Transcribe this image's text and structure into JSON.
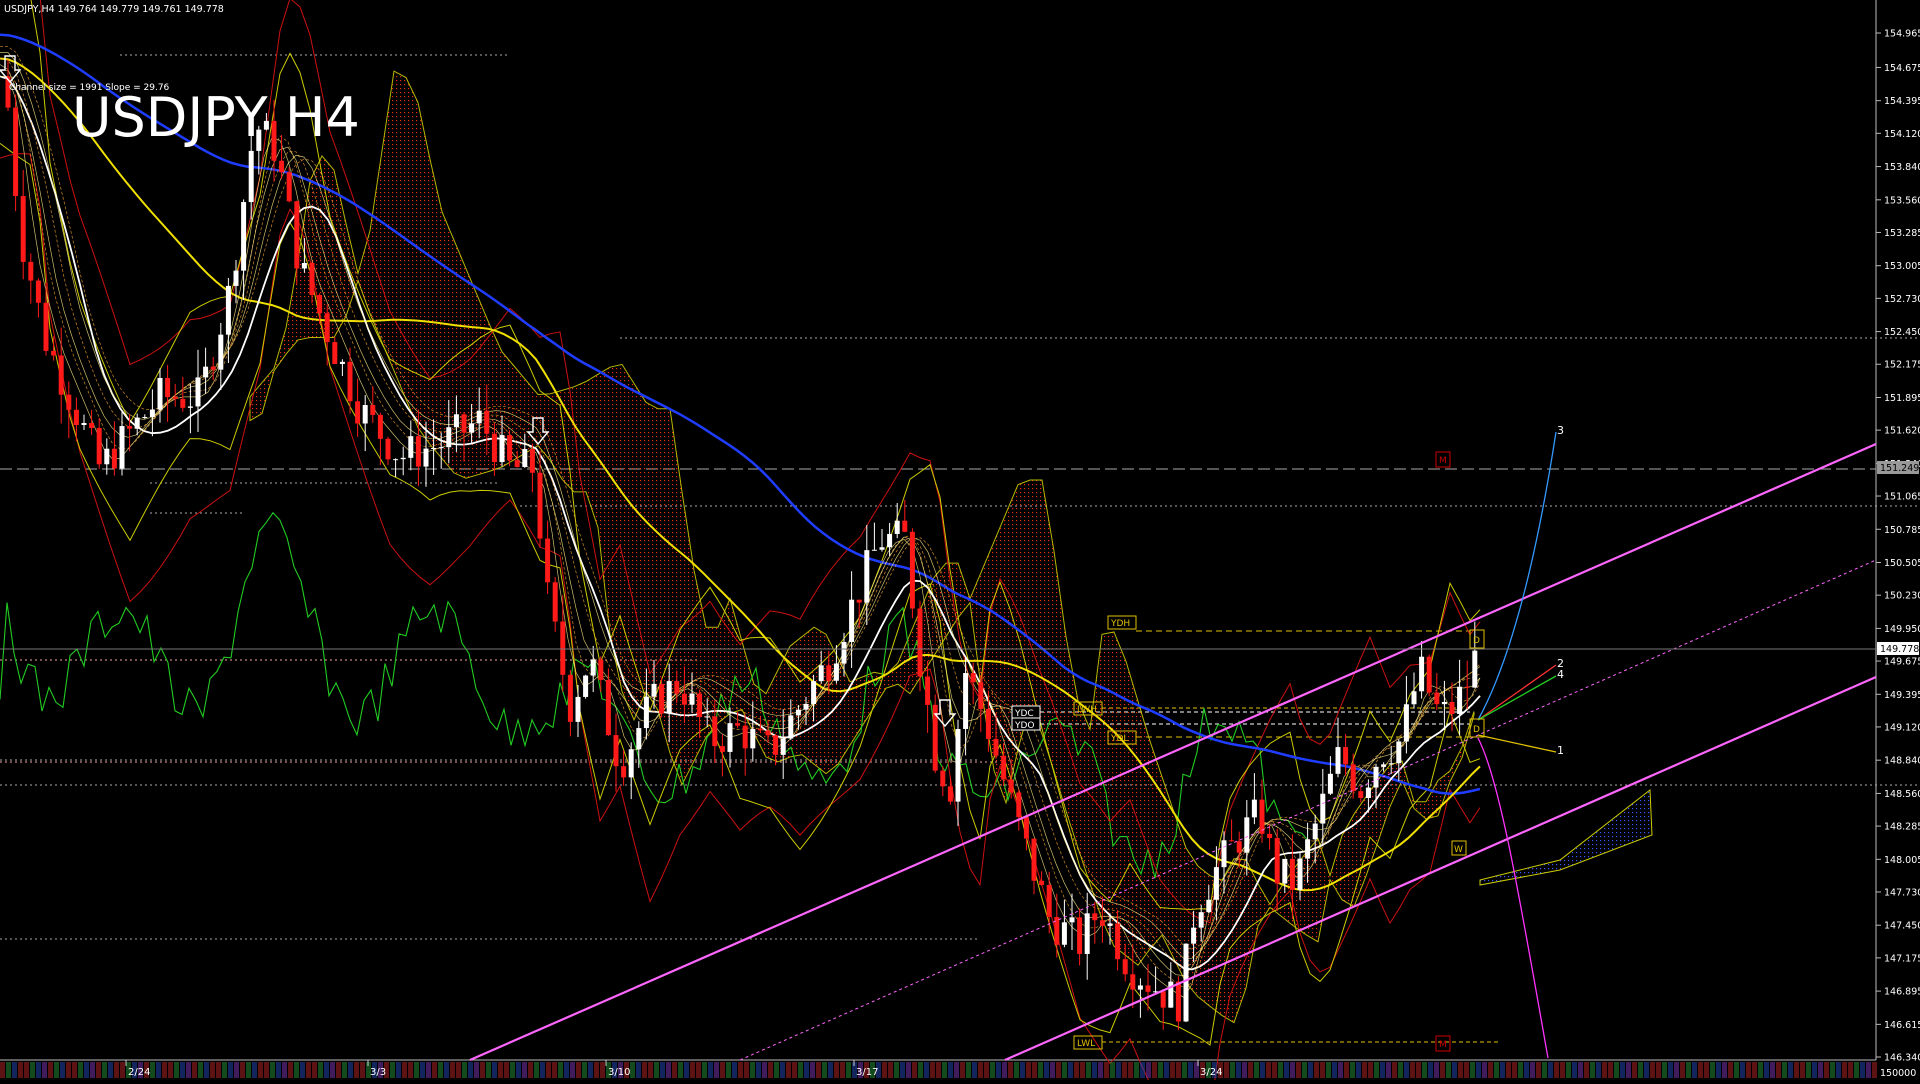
{
  "window": {
    "header_text": "USDJPY,H4  149.764 149.779 149.761 149.778",
    "title": "USDJPY H4",
    "channel_info": "Channel size = 1991 Slope = 29.76"
  },
  "price_scale": {
    "ticks": [
      "154.965",
      "154.675",
      "154.395",
      "154.120",
      "153.840",
      "153.560",
      "153.285",
      "153.005",
      "152.730",
      "152.450",
      "152.175",
      "151.895",
      "151.620",
      "151.340",
      "151.065",
      "150.785",
      "150.505",
      "150.230",
      "149.950",
      "149.675",
      "149.395",
      "149.120",
      "148.840",
      "148.560",
      "148.285",
      "148.005",
      "147.730",
      "147.450",
      "147.175",
      "146.895",
      "146.615",
      "146.340"
    ],
    "current_price_tag": "149.778",
    "level_tag": "151.249",
    "bottom_label": "150000"
  },
  "time_axis": {
    "labels": [
      "2/24",
      "3/3",
      "3/10",
      "3/17",
      "3/24"
    ]
  },
  "level_labels": {
    "ydh": "YDH",
    "ydl": "YDL",
    "ydc": "YDC",
    "ydo": "YDO",
    "lwh": "LWH",
    "lwl": "LWL",
    "m_top": "M",
    "m_bottom": "M",
    "d_top": "D",
    "d_bottom": "D",
    "w_mark": "W"
  },
  "projection_labels": [
    "3",
    "2",
    "4",
    "1"
  ],
  "colors": {
    "background": "#000000",
    "bull_candle": "#ffffff",
    "bear_candle": "#ff1a1a",
    "ma_blue": "#1f3dff",
    "ma_yellow": "#f0e000",
    "ma_white": "#ffffff",
    "cloud": "#ff2200",
    "channel": "#ff66ff",
    "oscillator": "#22cc22",
    "level_line": "#e0c000"
  },
  "chart_data": {
    "type": "candlestick",
    "symbol": "USDJPY",
    "timeframe": "H4",
    "last_price": 149.778,
    "ylim": [
      146.34,
      155.2
    ],
    "x_range": [
      "2/19",
      "3/28"
    ],
    "grid": false,
    "annotated_levels": {
      "YDH": 149.95,
      "YDL": 149.06,
      "YDC": 149.23,
      "YDO": 149.15,
      "LWH": 149.28,
      "LWL": 146.56,
      "dashed_level": 151.249
    }
  }
}
